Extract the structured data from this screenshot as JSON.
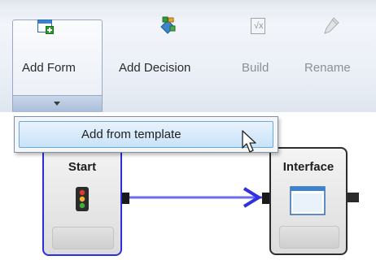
{
  "ribbon": {
    "add_form": {
      "label": "Add Form",
      "icon": "add-form-icon"
    },
    "add_decision": {
      "label": "Add Decision",
      "icon": "decision-icon"
    },
    "build": {
      "label": "Build",
      "icon": "build-icon",
      "enabled": false
    },
    "rename": {
      "label": "Rename",
      "icon": "rename-icon",
      "enabled": false
    }
  },
  "dropdown": {
    "items": [
      {
        "label": "Add from template"
      }
    ]
  },
  "canvas": {
    "nodes": [
      {
        "title": "Start",
        "icon": "traffic-light-icon",
        "selected": true
      },
      {
        "title": "Interface",
        "icon": "window-icon",
        "selected": false
      }
    ]
  },
  "colors": {
    "selection_blue": "#2d2de0",
    "connector_blue": "#6b6bf0",
    "menu_highlight": "#c8e2f8"
  }
}
